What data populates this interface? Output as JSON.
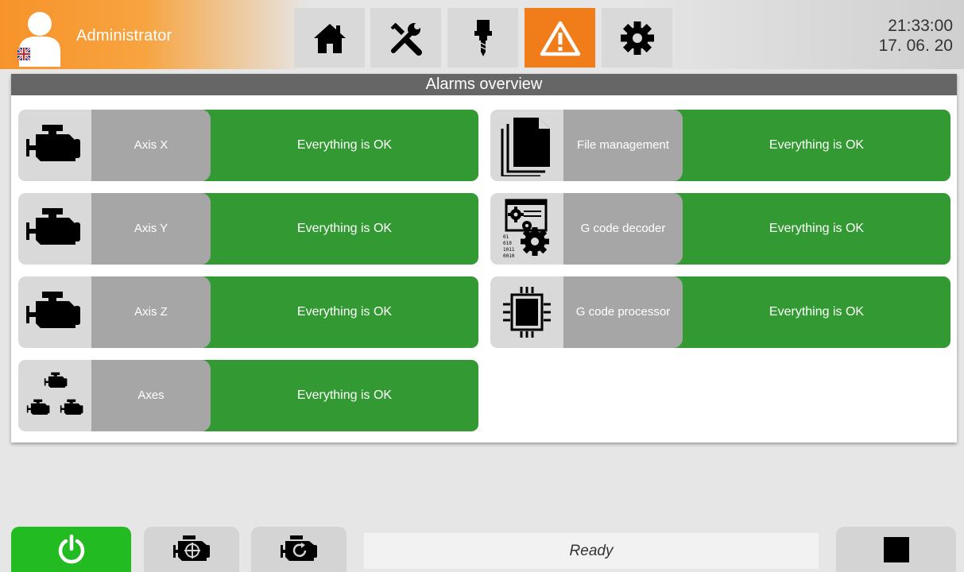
{
  "user": {
    "name": "Administrator",
    "language_flag": "uk-flag-icon"
  },
  "nav": [
    {
      "icon": "home-icon",
      "active": false
    },
    {
      "icon": "tools-icon",
      "active": false
    },
    {
      "icon": "spindle-icon",
      "active": false
    },
    {
      "icon": "warning-icon",
      "active": true
    },
    {
      "icon": "gear-icon",
      "active": false
    }
  ],
  "clock": {
    "time": "21:33:00",
    "date": "17. 06. 20"
  },
  "panel": {
    "title": "Alarms overview"
  },
  "alarms": [
    {
      "icon": "motor-icon",
      "name": "Axis X",
      "status": "Everything is OK"
    },
    {
      "icon": "motor-icon",
      "name": "Axis Y",
      "status": "Everything is OK"
    },
    {
      "icon": "motor-icon",
      "name": "Axis Z",
      "status": "Everything is OK"
    },
    {
      "icon": "motors-group-icon",
      "name": "Axes",
      "status": "Everything is OK"
    },
    {
      "icon": "documents-icon",
      "name": "File management",
      "status": "Everything is OK"
    },
    {
      "icon": "gcode-decoder-icon",
      "name": "G code decoder",
      "status": "Everything is OK"
    },
    {
      "icon": "cpu-chip-icon",
      "name": "G code processor",
      "status": "Everything is OK"
    }
  ],
  "bottom": {
    "status_text": "Ready",
    "buttons": [
      "power-icon",
      "motor-home-icon",
      "motor-reset-icon",
      "stop-icon"
    ]
  },
  "colors": {
    "accent_orange": "#f07d1a",
    "ok_green": "#339933",
    "power_green": "#22bb22",
    "title_gray": "#666666"
  }
}
